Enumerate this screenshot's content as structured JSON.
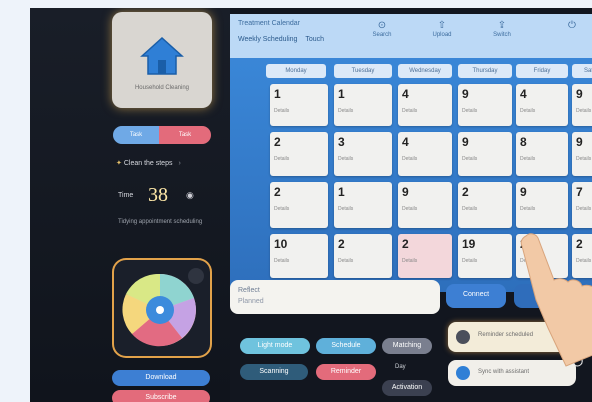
{
  "sidebar": {
    "home_caption": "Household Cleaning",
    "chips": [
      "Task",
      "Task"
    ],
    "clean_steps": "Clean the steps",
    "clean_steps_suffix": "›",
    "time_label": "Time",
    "time_value": "38",
    "subtext": "Tidying appointment scheduling",
    "buttons": {
      "primary": "Download",
      "secondary": "Subscribe"
    }
  },
  "calendar": {
    "title": "Treatment Calendar",
    "subtitle": "Weekly Scheduling",
    "subtitle_suffix": "Touch",
    "toolbar": [
      "Search",
      "Upload",
      "Switch"
    ],
    "columns": [
      "Monday",
      "Tuesday",
      "Wednesday",
      "Thursday",
      "Friday",
      "Saturday"
    ],
    "weeks": [
      [
        "1",
        "1",
        "4",
        "9",
        "4",
        "9"
      ],
      [
        "2",
        "3",
        "4",
        "9",
        "8",
        "9"
      ],
      [
        "2",
        "1",
        "9",
        "2",
        "9",
        "7"
      ],
      [
        "10",
        "2",
        "2",
        "19",
        "23",
        "2"
      ]
    ],
    "cell_note": "Details"
  },
  "bottom": {
    "input_label": "Reflect",
    "input_sub": "Planned",
    "action_primary": "Connect",
    "action_secondary": "Go",
    "bottom_pills": [
      "Light mode",
      "Schedule",
      "Matching",
      "Scanning",
      "Reminder",
      "Day",
      "Activation"
    ],
    "info1": "Reminder scheduled",
    "info2": "Sync with assistant"
  },
  "colors": {
    "accent": "#3c8bdc",
    "warning": "#e2a24a",
    "danger": "#e36b7b",
    "light_blue": "#6fa9e6"
  }
}
